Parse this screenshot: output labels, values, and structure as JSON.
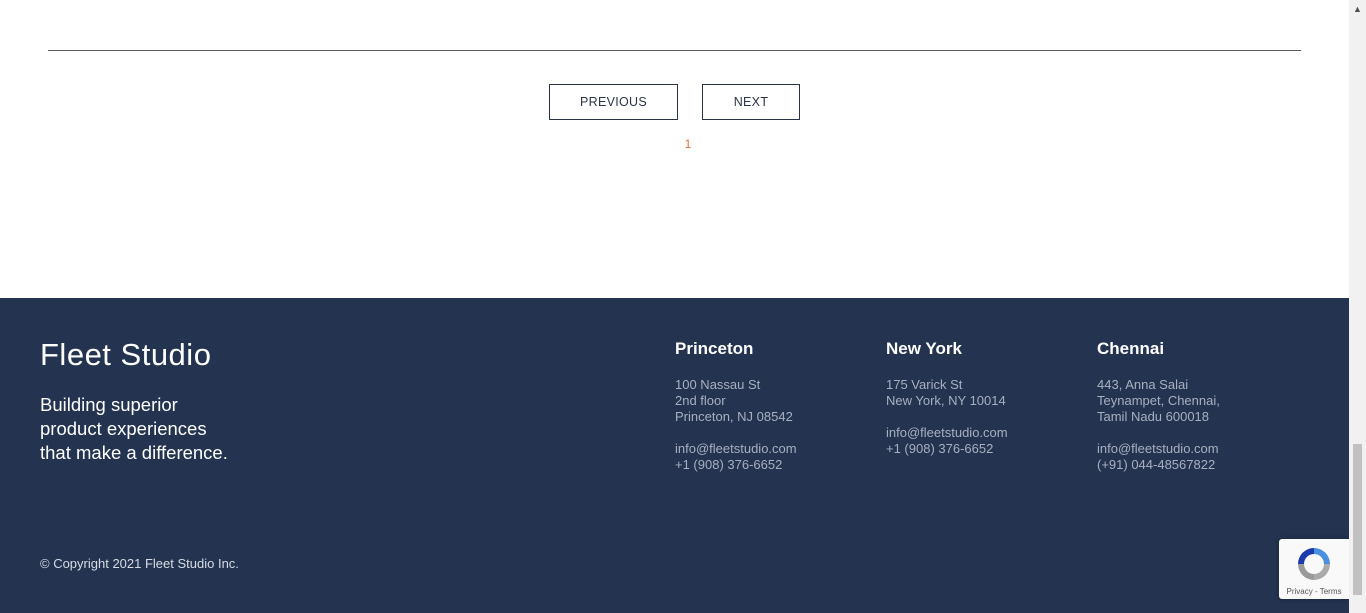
{
  "pagination": {
    "previous_label": "PREVIOUS",
    "next_label": "NEXT",
    "current_page": "1"
  },
  "footer": {
    "brand": "Fleet Studio",
    "tagline": [
      "Building superior",
      "product experiences",
      "that make a difference."
    ],
    "offices": [
      {
        "city": "Princeton",
        "address": [
          "100 Nassau St",
          "2nd floor",
          "Princeton, NJ 08542"
        ],
        "email": "info@fleetstudio.com",
        "phone": "+1 (908) 376-6652"
      },
      {
        "city": "New York",
        "address": [
          "175 Varick St",
          "New York, NY 10014"
        ],
        "email": "info@fleetstudio.com",
        "phone": "+1 (908) 376-6652"
      },
      {
        "city": "Chennai",
        "address": [
          "443, Anna Salai",
          "Teynampet, Chennai,",
          "Tamil Nadu 600018"
        ],
        "email": "info@fleetstudio.com",
        "phone": "(+91) 044-48567822"
      }
    ],
    "copyright": "© Copyright 2021 Fleet Studio Inc."
  },
  "recaptcha": {
    "links": "Privacy - Terms"
  },
  "colors": {
    "footer_bg": "#233350",
    "accent": "#e56a3d"
  }
}
